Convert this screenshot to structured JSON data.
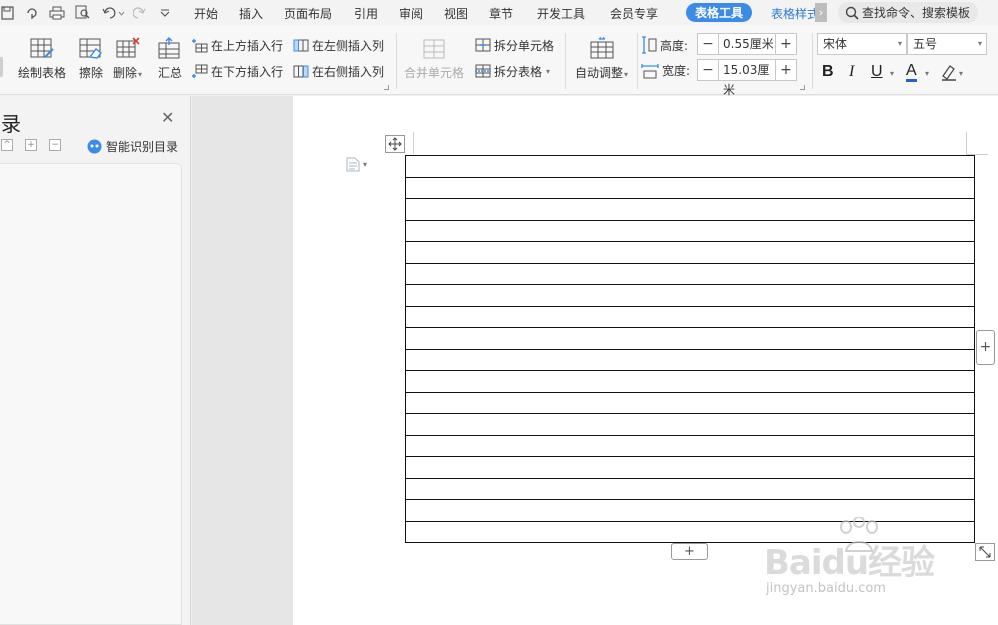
{
  "menubar": {
    "tabs": [
      "开始",
      "插入",
      "页面布局",
      "引用",
      "审阅",
      "视图",
      "章节",
      "开发工具",
      "会员专享"
    ],
    "active_tab": "表格工具",
    "next_tab": "表格样式",
    "search_text": "查找命令、搜索模板",
    "accent_color": "#3c8ce7"
  },
  "ribbon": {
    "draw_table": "绘制表格",
    "erase": "擦除",
    "delete": "删除",
    "summary": "汇总",
    "insert_row_above": "在上方插入行",
    "insert_row_below": "在下方插入行",
    "insert_col_left": "在左侧插入列",
    "insert_col_right": "在右侧插入列",
    "merge_cells": "合并单元格",
    "split_cells": "拆分单元格",
    "split_table": "拆分表格",
    "auto_fit": "自动调整",
    "height_label": "高度:",
    "height_value": "0.55厘米",
    "width_label": "宽度:",
    "width_value": "15.03厘米",
    "font_name": "宋体",
    "font_size": "五号"
  },
  "nav": {
    "title": "录",
    "smart_toc": "智能识别目录"
  },
  "document": {
    "table_rows": 18,
    "table_cols": 1
  },
  "watermark": {
    "brand": "Baidu经验",
    "url": "jingyan.baidu.com"
  }
}
